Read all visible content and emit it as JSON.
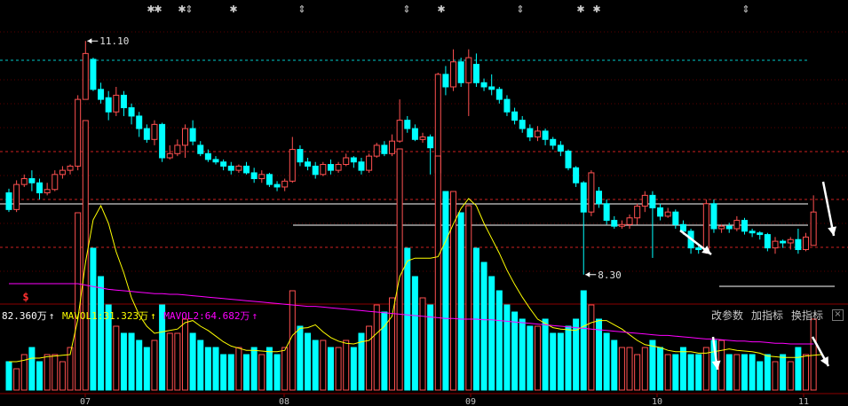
{
  "colors": {
    "up": "#ff5050",
    "down": "#00ffff",
    "bg": "#000000",
    "grid": "#8b0000",
    "ma1": "#ffff00",
    "ma2": "#ff00ff",
    "white": "#ffffff"
  },
  "price_labels": {
    "high": "11.10",
    "low": "8.30"
  },
  "special_marker": "$",
  "volume_info": {
    "volume": "82.360万",
    "mavol1_label": "MAVOL1:31.323万",
    "mavol2_label": "MAVOL2:64.682万"
  },
  "buttons": {
    "params": "改参数",
    "add_indicator": "加指标",
    "switch_indicator": "换指标",
    "close": "×"
  },
  "chart_data": {
    "type": "candlestick",
    "x_tick_labels": [
      "07",
      "08",
      "09",
      "10",
      "11"
    ],
    "price_ylim": [
      8.0,
      11.4
    ],
    "volume_ylim": [
      0,
      1000000
    ],
    "markers_top": [
      "✱",
      "✱",
      "✱",
      "⇕",
      "✱",
      "⇕",
      "⇕",
      "✱",
      "⇕",
      "✱",
      "✱",
      "⇕"
    ],
    "annotations": {
      "high_value": 11.1,
      "low_value": 8.3
    },
    "candles": [
      [
        9.28,
        9.08,
        9.33,
        9.05
      ],
      [
        9.08,
        9.38,
        9.43,
        9.05
      ],
      [
        9.38,
        9.45,
        9.5,
        9.35
      ],
      [
        9.45,
        9.4,
        9.55,
        9.3
      ],
      [
        9.4,
        9.28,
        9.45,
        9.2
      ],
      [
        9.28,
        9.32,
        9.4,
        9.25
      ],
      [
        9.32,
        9.5,
        9.55,
        9.3
      ],
      [
        9.5,
        9.55,
        9.6,
        9.45
      ],
      [
        9.55,
        9.6,
        9.62,
        9.5
      ],
      [
        9.6,
        10.4,
        10.45,
        9.55
      ],
      [
        10.4,
        10.95,
        11.1,
        10.4
      ],
      [
        10.88,
        10.52,
        10.9,
        10.5
      ],
      [
        10.52,
        10.4,
        10.6,
        10.35
      ],
      [
        10.42,
        10.25,
        10.5,
        10.15
      ],
      [
        10.25,
        10.45,
        10.55,
        10.2
      ],
      [
        10.45,
        10.3,
        10.5,
        10.2
      ],
      [
        10.3,
        10.2,
        10.35,
        10.1
      ],
      [
        10.2,
        10.05,
        10.25,
        9.95
      ],
      [
        10.05,
        9.92,
        10.1,
        9.88
      ],
      [
        9.92,
        10.1,
        10.15,
        9.85
      ],
      [
        10.1,
        9.7,
        10.12,
        9.65
      ],
      [
        9.7,
        9.75,
        9.85,
        9.68
      ],
      [
        9.75,
        9.85,
        9.92,
        9.72
      ],
      [
        9.85,
        10.05,
        10.1,
        9.7
      ],
      [
        10.05,
        9.9,
        10.15,
        9.85
      ],
      [
        9.85,
        9.75,
        9.9,
        9.72
      ],
      [
        9.75,
        9.68,
        9.8,
        9.65
      ],
      [
        9.68,
        9.65,
        9.72,
        9.62
      ],
      [
        9.65,
        9.6,
        9.68,
        9.55
      ],
      [
        9.6,
        9.55,
        9.65,
        9.5
      ],
      [
        9.55,
        9.6,
        9.62,
        9.52
      ],
      [
        9.6,
        9.52,
        9.65,
        9.5
      ],
      [
        9.52,
        9.45,
        9.58,
        9.4
      ],
      [
        9.45,
        9.5,
        9.55,
        9.4
      ],
      [
        9.5,
        9.38,
        9.52,
        9.35
      ],
      [
        9.38,
        9.35,
        9.42,
        9.3
      ],
      [
        9.35,
        9.42,
        9.45,
        9.3
      ],
      [
        9.42,
        9.8,
        9.95,
        9.4
      ],
      [
        9.8,
        9.65,
        9.85,
        9.6
      ],
      [
        9.65,
        9.6,
        9.7,
        9.55
      ],
      [
        9.6,
        9.5,
        9.65,
        9.45
      ],
      [
        9.5,
        9.62,
        9.65,
        9.48
      ],
      [
        9.62,
        9.55,
        9.68,
        9.5
      ],
      [
        9.55,
        9.62,
        9.65,
        9.52
      ],
      [
        9.62,
        9.7,
        9.75,
        9.6
      ],
      [
        9.7,
        9.65,
        9.72,
        9.58
      ],
      [
        9.65,
        9.55,
        9.7,
        9.5
      ],
      [
        9.55,
        9.72,
        9.75,
        9.52
      ],
      [
        9.72,
        9.85,
        9.88,
        9.7
      ],
      [
        9.85,
        9.75,
        9.9,
        9.72
      ],
      [
        9.75,
        9.9,
        9.98,
        9.72
      ],
      [
        9.9,
        10.15,
        10.4,
        9.88
      ],
      [
        10.15,
        10.05,
        10.2,
        10.0
      ],
      [
        10.05,
        9.92,
        10.1,
        9.9
      ],
      [
        9.92,
        9.95,
        10.0,
        9.88
      ],
      [
        9.95,
        9.82,
        9.98,
        9.5
      ],
      [
        9.52,
        10.7,
        10.72,
        9.5
      ],
      [
        10.7,
        10.55,
        10.8,
        10.45
      ],
      [
        10.55,
        10.85,
        11.0,
        10.5
      ],
      [
        10.85,
        10.6,
        10.9,
        10.55
      ],
      [
        10.6,
        10.9,
        11.0,
        10.2
      ],
      [
        10.82,
        10.6,
        10.95,
        10.55
      ],
      [
        10.6,
        10.55,
        10.65,
        10.5
      ],
      [
        10.55,
        10.52,
        10.7,
        10.45
      ],
      [
        10.52,
        10.4,
        10.55,
        10.35
      ],
      [
        10.4,
        10.25,
        10.45,
        10.2
      ],
      [
        10.25,
        10.15,
        10.3,
        10.1
      ],
      [
        10.15,
        10.05,
        10.2,
        10.0
      ],
      [
        10.05,
        9.95,
        10.1,
        9.9
      ],
      [
        9.95,
        10.02,
        10.08,
        9.9
      ],
      [
        10.02,
        9.92,
        10.05,
        9.85
      ],
      [
        9.92,
        9.85,
        9.95,
        9.8
      ],
      [
        9.85,
        9.78,
        9.9,
        9.72
      ],
      [
        9.78,
        9.58,
        9.8,
        9.55
      ],
      [
        9.58,
        9.4,
        9.6,
        9.35
      ],
      [
        9.4,
        9.05,
        9.42,
        8.3
      ],
      [
        9.05,
        9.52,
        9.55,
        9.0
      ],
      [
        9.3,
        9.15,
        9.35,
        9.1
      ],
      [
        9.15,
        8.95,
        9.2,
        8.9
      ],
      [
        8.95,
        8.88,
        9.0,
        8.85
      ],
      [
        8.88,
        8.9,
        8.95,
        8.85
      ],
      [
        8.9,
        8.98,
        9.02,
        8.85
      ],
      [
        8.98,
        9.12,
        9.15,
        8.9
      ],
      [
        9.12,
        9.25,
        9.3,
        9.05
      ],
      [
        9.25,
        9.1,
        9.3,
        8.5
      ],
      [
        9.1,
        9.0,
        9.15,
        8.95
      ],
      [
        9.0,
        9.05,
        9.1,
        8.98
      ],
      [
        9.05,
        8.9,
        9.08,
        8.85
      ],
      [
        8.9,
        8.82,
        8.95,
        8.78
      ],
      [
        8.82,
        8.62,
        8.85,
        8.55
      ],
      [
        8.62,
        8.6,
        8.65,
        8.55
      ],
      [
        8.6,
        9.15,
        9.2,
        8.55
      ],
      [
        9.15,
        8.85,
        9.2,
        8.8
      ],
      [
        8.85,
        8.88,
        8.9,
        8.8
      ],
      [
        8.88,
        8.85,
        8.92,
        8.8
      ],
      [
        8.85,
        8.95,
        9.0,
        8.82
      ],
      [
        8.95,
        8.82,
        8.98,
        8.78
      ],
      [
        8.82,
        8.8,
        8.85,
        8.75
      ],
      [
        8.8,
        8.78,
        8.82,
        8.72
      ],
      [
        8.78,
        8.62,
        8.8,
        8.58
      ],
      [
        8.62,
        8.7,
        8.75,
        8.55
      ],
      [
        8.7,
        8.68,
        8.72,
        8.62
      ],
      [
        8.68,
        8.72,
        8.75,
        8.6
      ],
      [
        8.72,
        8.6,
        8.85,
        8.55
      ],
      [
        8.6,
        8.75,
        8.8,
        8.58
      ],
      [
        8.65,
        9.05,
        9.25,
        8.65
      ]
    ],
    "volumes": [
      40,
      30,
      50,
      60,
      40,
      50,
      50,
      40,
      60,
      250,
      380,
      200,
      160,
      120,
      90,
      80,
      80,
      70,
      60,
      70,
      120,
      80,
      80,
      100,
      80,
      70,
      60,
      60,
      50,
      50,
      60,
      50,
      60,
      50,
      60,
      50,
      60,
      140,
      90,
      80,
      70,
      70,
      60,
      60,
      70,
      60,
      80,
      90,
      120,
      110,
      130,
      340,
      200,
      160,
      130,
      120,
      330,
      280,
      280,
      250,
      260,
      200,
      180,
      160,
      140,
      120,
      110,
      100,
      90,
      90,
      100,
      80,
      80,
      90,
      100,
      140,
      120,
      100,
      80,
      70,
      60,
      60,
      50,
      60,
      70,
      60,
      50,
      50,
      60,
      50,
      50,
      60,
      70,
      70,
      50,
      50,
      50,
      50,
      40,
      50,
      40,
      50,
      40,
      60,
      50,
      100
    ],
    "ma1": [
      40,
      40,
      42,
      45,
      45,
      47,
      48,
      49,
      50,
      100,
      180,
      240,
      260,
      235,
      195,
      165,
      130,
      106,
      90,
      80,
      82,
      84,
      86,
      95,
      98,
      90,
      84,
      76,
      68,
      62,
      59,
      56,
      56,
      55,
      54,
      54,
      56,
      77,
      87,
      88,
      92,
      82,
      74,
      69,
      66,
      65,
      68,
      70,
      80,
      90,
      104,
      160,
      182,
      186,
      186,
      186,
      188,
      210,
      234,
      256,
      270,
      260,
      235,
      214,
      193,
      169,
      149,
      131,
      115,
      100,
      94,
      88,
      86,
      85,
      84,
      90,
      95,
      98,
      98,
      92,
      86,
      78,
      70,
      64,
      62,
      60,
      56,
      54,
      54,
      54,
      52,
      52,
      54,
      56,
      58,
      56,
      55,
      54,
      52,
      48,
      47,
      46,
      46,
      46,
      48,
      49,
      50
    ],
    "ma2": [
      150,
      150,
      150,
      150,
      150,
      150,
      150,
      150,
      150,
      150,
      148,
      146,
      144,
      142,
      141,
      140,
      139,
      138,
      137,
      136,
      136,
      135,
      135,
      134,
      133,
      132,
      131,
      130,
      129,
      128,
      127,
      126,
      125,
      124,
      123,
      122,
      121,
      120,
      119,
      118,
      118,
      117,
      116,
      115,
      114,
      113,
      112,
      111,
      110,
      109,
      108,
      107,
      106,
      105,
      104,
      103,
      102,
      101,
      101,
      100,
      100,
      100,
      99,
      99,
      98,
      97,
      96,
      95,
      94,
      93,
      92,
      91,
      90,
      89,
      88,
      87,
      86,
      85,
      84,
      83,
      82,
      81,
      80,
      79,
      78,
      77,
      77,
      76,
      75,
      74,
      73,
      72,
      72,
      71,
      70,
      69,
      69,
      68,
      68,
      67,
      66,
      66,
      65,
      65,
      65,
      65
    ]
  }
}
